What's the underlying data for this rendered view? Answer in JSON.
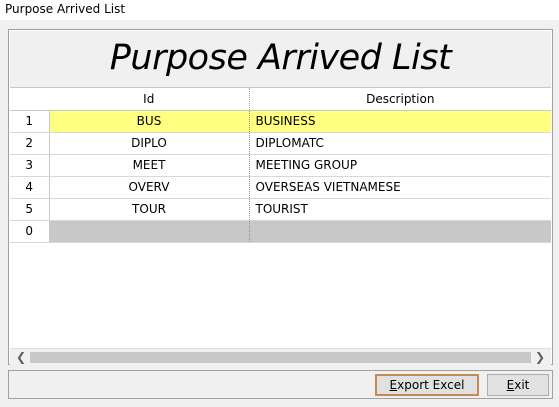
{
  "window": {
    "title": "Purpose Arrived List"
  },
  "banner": {
    "title": "Purpose Arrived List"
  },
  "grid": {
    "columns": {
      "id": "Id",
      "description": "Description"
    },
    "rows": [
      {
        "num": "1",
        "id": "BUS",
        "description": "BUSINESS"
      },
      {
        "num": "2",
        "id": "DIPLO",
        "description": "DIPLOMATC"
      },
      {
        "num": "3",
        "id": "MEET",
        "description": "MEETING GROUP"
      },
      {
        "num": "4",
        "id": "OVERV",
        "description": "OVERSEAS VIETNAMESE"
      },
      {
        "num": "5",
        "id": "TOUR",
        "description": "TOURIST"
      },
      {
        "num": "0",
        "id": "",
        "description": ""
      }
    ]
  },
  "buttons": {
    "export_first": "E",
    "export_rest": "xport Excel",
    "exit_first": "E",
    "exit_rest": "xit"
  },
  "icons": {
    "scroll_left": "chevron-left-icon",
    "scroll_right": "chevron-right-icon"
  },
  "colors": {
    "selected_row": "#ffff80",
    "new_row": "#c8c8c8",
    "export_border": "#c48a55"
  }
}
